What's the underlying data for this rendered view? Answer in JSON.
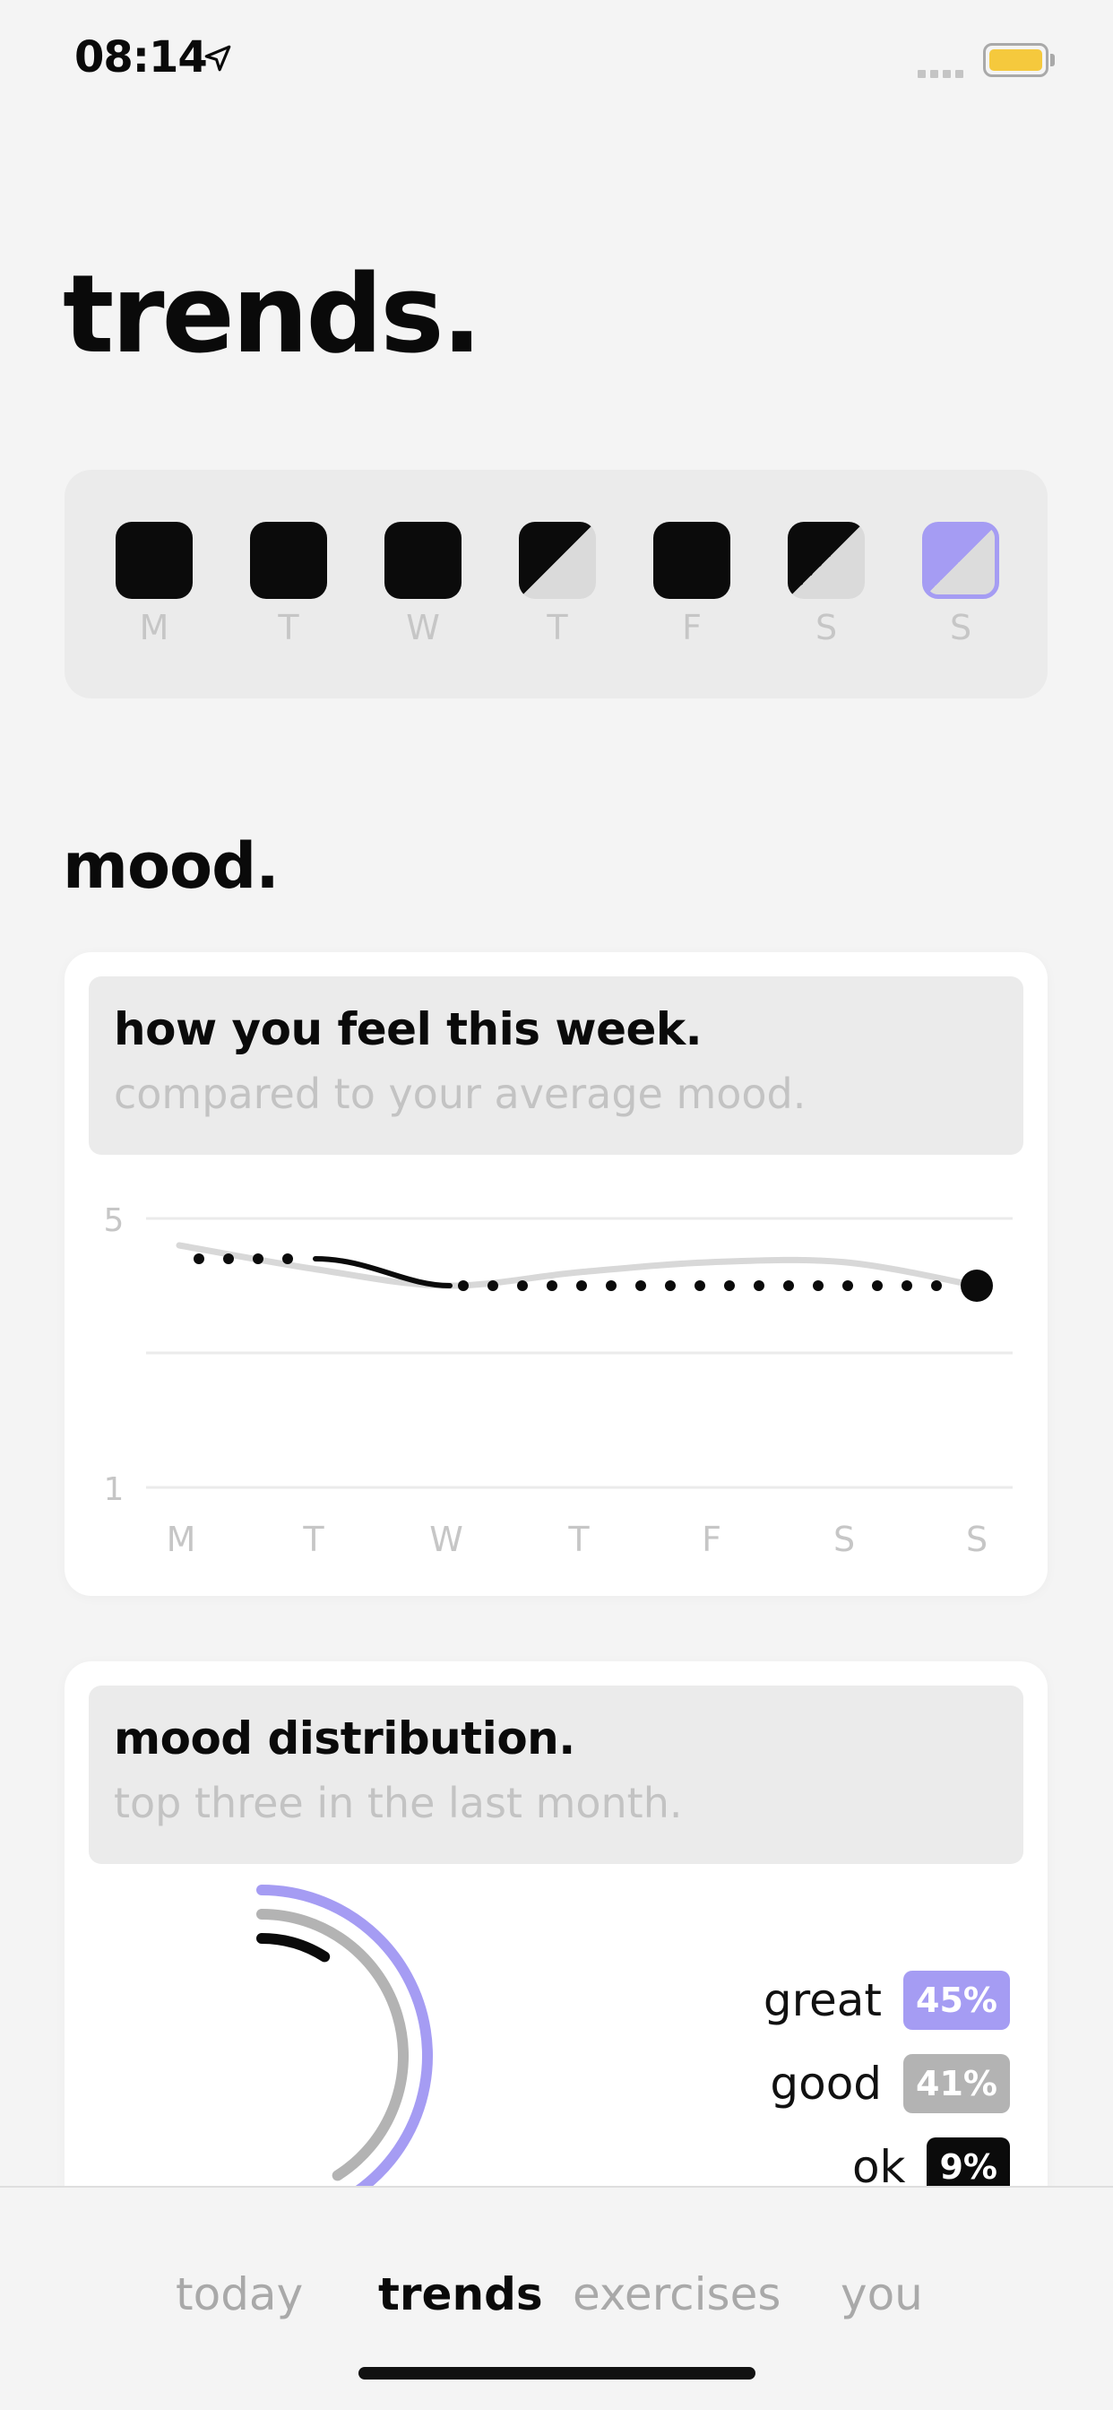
{
  "status_bar": {
    "time": "08:14",
    "location_icon": "location-arrow-icon",
    "battery_color": "#f5c93d"
  },
  "page": {
    "title": "trends."
  },
  "week": {
    "days": [
      {
        "label": "M",
        "state": "full"
      },
      {
        "label": "T",
        "state": "full"
      },
      {
        "label": "W",
        "state": "full"
      },
      {
        "label": "T",
        "state": "half"
      },
      {
        "label": "F",
        "state": "full"
      },
      {
        "label": "S",
        "state": "half"
      },
      {
        "label": "S",
        "state": "today"
      }
    ]
  },
  "mood_section": {
    "title": "mood."
  },
  "weekly_card": {
    "title": "how you feel this week.",
    "subtitle": "compared to your average mood."
  },
  "distribution_card": {
    "title": "mood distribution.",
    "subtitle": "top three in the last month.",
    "items": [
      {
        "label": "great",
        "percent": "45%",
        "color": "#a59cf3"
      },
      {
        "label": "good",
        "percent": "41%",
        "color": "#b3b3b3"
      },
      {
        "label": "ok",
        "percent": "9%",
        "color": "#0b0b0b"
      }
    ]
  },
  "chart_data": [
    {
      "type": "line",
      "categories": [
        "M",
        "T",
        "W",
        "T",
        "F",
        "S",
        "S"
      ],
      "ylim": [
        1,
        5
      ],
      "y_ticks": [
        5,
        1
      ],
      "grid": true,
      "series": [
        {
          "style": "average",
          "color": "#d8d8d8",
          "values": [
            4.6,
            4.25,
            4.0,
            4.2,
            4.35,
            4.35,
            4.0
          ]
        },
        {
          "style": "this-week",
          "color": "#0b0b0b",
          "values": [
            4.4,
            4.4,
            4.0,
            4.0,
            4.0,
            4.0,
            4.0
          ]
        }
      ]
    },
    {
      "type": "pie",
      "categories": [
        "great",
        "good",
        "ok"
      ],
      "values": [
        45,
        41,
        9
      ],
      "colors": [
        "#a59cf3",
        "#b3b3b3",
        "#0b0b0b"
      ]
    }
  ],
  "tabs": [
    {
      "label": "today",
      "active": false
    },
    {
      "label": "trends",
      "active": true
    },
    {
      "label": "exercises",
      "active": false
    },
    {
      "label": "you",
      "active": false
    }
  ]
}
